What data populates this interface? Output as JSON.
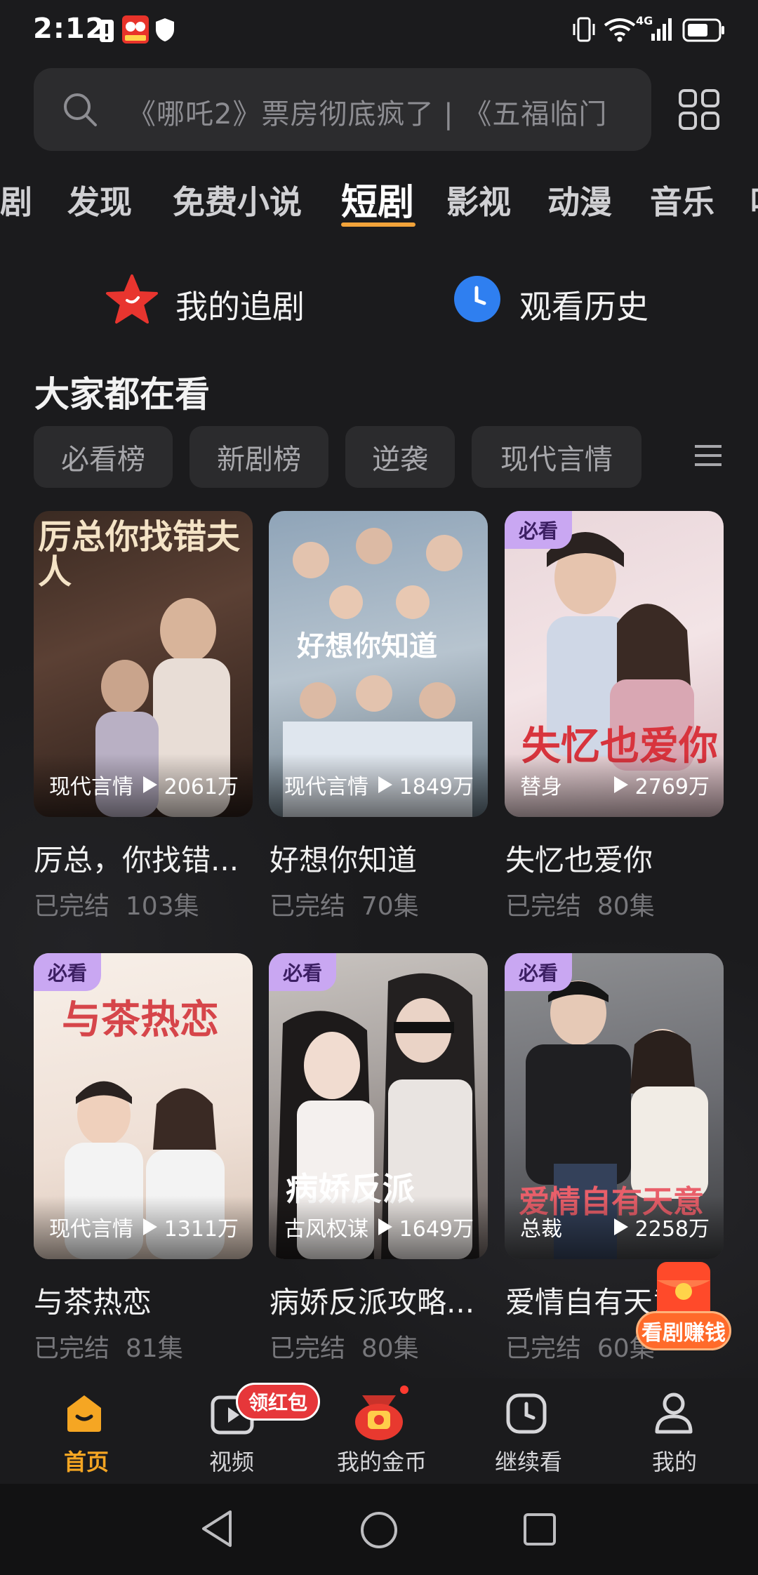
{
  "status_bar": {
    "time": "2:12",
    "network": "4G"
  },
  "search": {
    "placeholder": "《哪吒2》票房彻底疯了 | 《五福临门"
  },
  "tabs": [
    {
      "label": "剧"
    },
    {
      "label": "发现"
    },
    {
      "label": "免费小说"
    },
    {
      "label": "短剧",
      "active": true
    },
    {
      "label": "影视"
    },
    {
      "label": "动漫"
    },
    {
      "label": "音乐"
    },
    {
      "label": "叫"
    }
  ],
  "quick": {
    "follow": "我的追剧",
    "history": "观看历史"
  },
  "section": {
    "title": "大家都在看"
  },
  "chips": [
    "必看榜",
    "新剧榜",
    "逆袭",
    "现代言情"
  ],
  "cards": [
    {
      "title": "厉总，你找错...",
      "tag": "现代言情",
      "plays": "2061万",
      "status": "已完结",
      "episodes": "103集",
      "badge": "",
      "poster_text": "厉总你找错夫人"
    },
    {
      "title": "好想你知道",
      "tag": "现代言情",
      "plays": "1849万",
      "status": "已完结",
      "episodes": "70集",
      "badge": "",
      "poster_text": "好想你知道"
    },
    {
      "title": "失忆也爱你",
      "tag": "替身",
      "plays": "2769万",
      "status": "已完结",
      "episodes": "80集",
      "badge": "必看",
      "poster_text": "失忆也爱你"
    },
    {
      "title": "与茶热恋",
      "tag": "现代言情",
      "plays": "1311万",
      "status": "已完结",
      "episodes": "81集",
      "badge": "必看",
      "poster_text": "与茶热恋"
    },
    {
      "title": "病娇反派攻略...",
      "tag": "古风权谋",
      "plays": "1649万",
      "status": "已完结",
      "episodes": "80集",
      "badge": "必看",
      "poster_text": "病娇反派"
    },
    {
      "title": "爱情自有天意",
      "tag": "总裁",
      "plays": "2258万",
      "status": "已完结",
      "episodes": "60集",
      "badge": "必看",
      "poster_text": "爱情自有天意"
    }
  ],
  "float_promo": {
    "label": "看剧赚钱"
  },
  "bottom_nav": [
    {
      "label": "首页",
      "active": true
    },
    {
      "label": "视频",
      "badge": "领红包"
    },
    {
      "label": "我的金币"
    },
    {
      "label": "继续看"
    },
    {
      "label": "我的"
    }
  ],
  "colors": {
    "accent": "#f2a33a",
    "badge_bg": "#c9a7f2",
    "promo": "#ff6a2a"
  }
}
